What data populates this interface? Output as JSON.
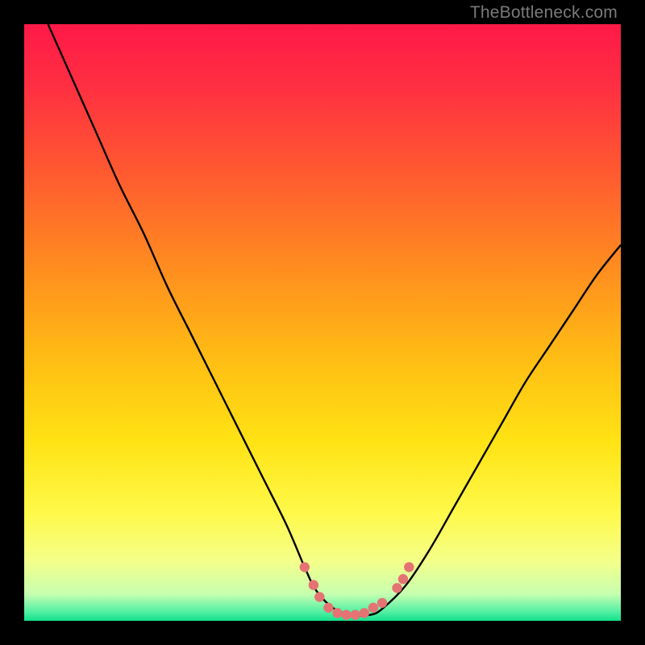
{
  "watermark": "TheBottleneck.com",
  "colors": {
    "black": "#000000",
    "curve": "#000000",
    "marker_fill": "#e57373",
    "marker_stroke": "#c05858",
    "gradient_stops": [
      {
        "offset": 0.0,
        "color": "#ff1947"
      },
      {
        "offset": 0.1,
        "color": "#ff2e42"
      },
      {
        "offset": 0.25,
        "color": "#ff5a30"
      },
      {
        "offset": 0.4,
        "color": "#ff8a20"
      },
      {
        "offset": 0.55,
        "color": "#ffba14"
      },
      {
        "offset": 0.7,
        "color": "#ffe314"
      },
      {
        "offset": 0.82,
        "color": "#fff94a"
      },
      {
        "offset": 0.9,
        "color": "#f4ff8a"
      },
      {
        "offset": 0.955,
        "color": "#c7ffb0"
      },
      {
        "offset": 0.985,
        "color": "#52f0a4"
      },
      {
        "offset": 1.0,
        "color": "#13e08b"
      }
    ]
  },
  "chart_data": {
    "type": "line",
    "title": "",
    "xlabel": "",
    "ylabel": "",
    "xlim": [
      0,
      100
    ],
    "ylim": [
      0,
      100
    ],
    "grid": false,
    "legend": false,
    "note": "Axes have no tick labels; values are estimated from pixel positions on a 0–100 scale. y = bottleneck/mismatch percentage (0 at bottom green zone, 100 at top red zone).",
    "series": [
      {
        "name": "bottleneck-curve",
        "x": [
          4,
          8,
          12,
          16,
          20,
          24,
          28,
          32,
          36,
          40,
          44,
          47,
          49,
          52,
          55,
          58,
          60,
          64,
          68,
          72,
          76,
          80,
          84,
          88,
          92,
          96,
          100
        ],
        "y": [
          100,
          91,
          82,
          73,
          65,
          56,
          48,
          40,
          32,
          24,
          16,
          9,
          5,
          2,
          1,
          1,
          2,
          6,
          12,
          19,
          26,
          33,
          40,
          46,
          52,
          58,
          63
        ]
      }
    ],
    "markers": {
      "name": "highlighted-points",
      "points": [
        {
          "x": 47.0,
          "y": 9.0
        },
        {
          "x": 48.5,
          "y": 6.0
        },
        {
          "x": 49.5,
          "y": 4.0
        },
        {
          "x": 51.0,
          "y": 2.2
        },
        {
          "x": 52.5,
          "y": 1.3
        },
        {
          "x": 54.0,
          "y": 1.0
        },
        {
          "x": 55.5,
          "y": 1.0
        },
        {
          "x": 57.0,
          "y": 1.3
        },
        {
          "x": 58.5,
          "y": 2.2
        },
        {
          "x": 60.0,
          "y": 3.0
        },
        {
          "x": 62.5,
          "y": 5.5
        },
        {
          "x": 63.5,
          "y": 7.0
        },
        {
          "x": 64.5,
          "y": 9.0
        }
      ]
    }
  }
}
